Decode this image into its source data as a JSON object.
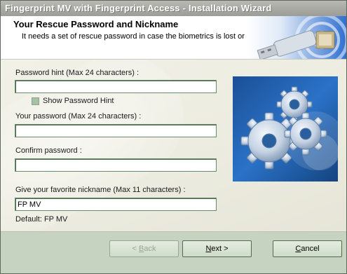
{
  "window": {
    "title": "Fingerprint MV with Fingerprint Access - Installation Wizard"
  },
  "header": {
    "title": "Your Rescue Password and Nickname",
    "subtitle": "It needs a set of rescue password  in case the biometrics is lost or broken."
  },
  "form": {
    "password_hint": {
      "label": "Password hint (Max 24 characters) :",
      "value": ""
    },
    "show_hint": {
      "label": "Show Password Hint",
      "checked": false
    },
    "password": {
      "label": "Your password (Max 24 characters) :",
      "value": ""
    },
    "confirm": {
      "label": "Confirm password :",
      "value": ""
    },
    "nickname": {
      "label": "Give your favorite nickname (Max 11 characters) :",
      "value": "FP MV"
    },
    "default_text": "Default: FP MV"
  },
  "buttons": {
    "back": {
      "mnemonic": "B",
      "rest": "ack",
      "prefix": "< ",
      "enabled": false
    },
    "next": {
      "mnemonic": "N",
      "rest": "ext",
      "suffix": " >",
      "enabled": true
    },
    "cancel": {
      "mnemonic": "C",
      "rest": "ancel",
      "enabled": true
    }
  },
  "colors": {
    "titlebar": "#a8a9a3",
    "footer": "#c5d3c0",
    "input_border": "#6a8c6a",
    "gear_bg": "#1d5fae"
  },
  "icons": [
    "usb-key-icon",
    "gears-image"
  ]
}
